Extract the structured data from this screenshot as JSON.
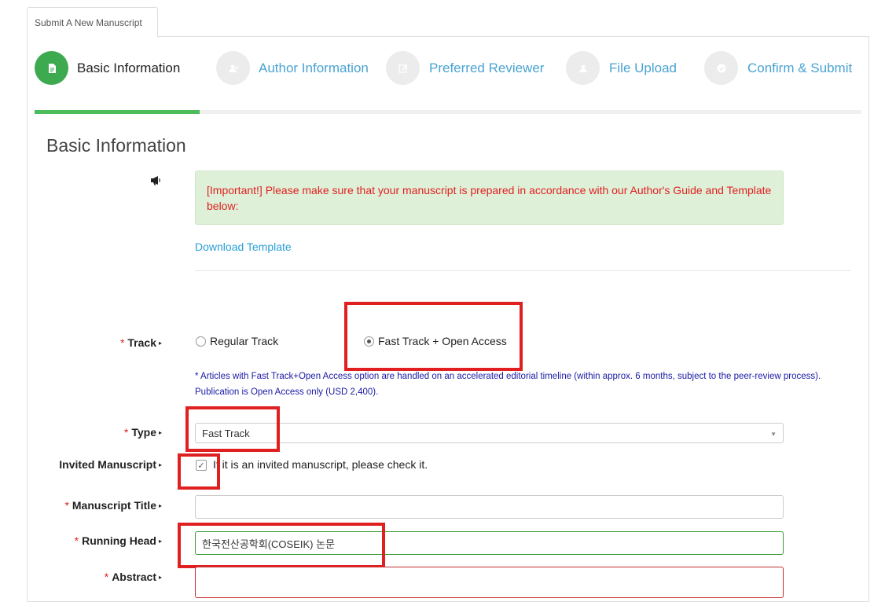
{
  "tab": {
    "label": "Submit A New Manuscript"
  },
  "steps": [
    {
      "label": "Basic Information",
      "icon": "document-icon",
      "active": true
    },
    {
      "label": "Author Information",
      "icon": "add-user-icon",
      "active": false
    },
    {
      "label": "Preferred Reviewer",
      "icon": "edit-icon",
      "active": false
    },
    {
      "label": "File Upload",
      "icon": "upload-icon",
      "active": false
    },
    {
      "label": "Confirm & Submit",
      "icon": "check-circle-icon",
      "active": false
    }
  ],
  "progress": {
    "completed_fraction": 0.2
  },
  "section": {
    "title": "Basic Information"
  },
  "notice": {
    "icon": "megaphone-icon",
    "text": "[Important!] Please make sure that your manuscript is prepared in accordance with our Author's Guide and Template below:",
    "download_link": "Download Template"
  },
  "form": {
    "track": {
      "label": "Track",
      "options": [
        "Regular Track",
        "Fast Track + Open Access"
      ],
      "selected": "Fast Track + Open Access",
      "note": "* Articles with Fast Track+Open Access option are handled on an accelerated editorial timeline (within approx. 6 months, subject to the peer-review process). Publication is Open Access only (USD 2,400)."
    },
    "type": {
      "label": "Type",
      "value": "Fast Track"
    },
    "invited": {
      "label": "Invited Manuscript",
      "checked": true,
      "text": "If it is an invited manuscript, please check it."
    },
    "title": {
      "label": "Manuscript Title",
      "value": ""
    },
    "running_head": {
      "label": "Running Head",
      "value": "한국전산공학회(COSEIK) 논문"
    },
    "abstract": {
      "label": "Abstract",
      "value": ""
    }
  },
  "colors": {
    "accent_green": "#3daa4f",
    "link_blue": "#2a9fd6",
    "alert_red": "#e02020",
    "highlight_red": "#e02020"
  }
}
